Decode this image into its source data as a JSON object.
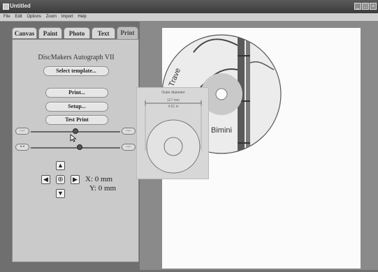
{
  "window": {
    "title": "Untitled"
  },
  "menu": [
    "File",
    "Edit",
    "Options",
    "Zoom",
    "Import",
    "Help"
  ],
  "tabs": [
    "Canvas",
    "Paint",
    "Photo",
    "Text",
    "Print"
  ],
  "active_tab": "Print",
  "print_panel": {
    "device_name": "DiscMakers Autograph VII",
    "select_template": "Select template...",
    "print": "Print...",
    "setup": "Setup...",
    "test_print": "Test Print",
    "slider1_value": 0.5,
    "slider2_value": 0.55,
    "x_readout": "X: 0 mm",
    "y_readout": "Y: 0 mm"
  },
  "popup": {
    "title": "Outer diameter",
    "dim_mm": "117 mm",
    "dim_in": "4.61 in"
  },
  "disc": {
    "text_top": "Trave",
    "text_bottom": "Bimini"
  },
  "colors": {
    "panel": "#cacaca",
    "background": "#8a8a8a",
    "paper": "#fbfbfb"
  }
}
